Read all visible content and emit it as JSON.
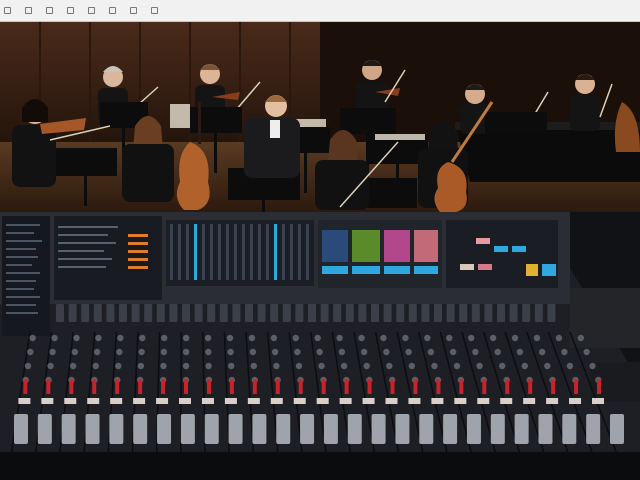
{
  "menu_bar": {
    "items": [
      "",
      "",
      "",
      "",
      "",
      "",
      "",
      "",
      "",
      ""
    ]
  },
  "scene": {
    "photo_colors": {
      "wall": "#3a2418",
      "floor": "#4a3020",
      "suit": "#141414",
      "wood": "#a5572a"
    },
    "musicians": [
      {
        "instrument": "violin"
      },
      {
        "instrument": "violin"
      },
      {
        "instrument": "violin"
      },
      {
        "instrument": "violin"
      },
      {
        "instrument": "violin"
      },
      {
        "instrument": "violin"
      },
      {
        "instrument": "viola"
      },
      {
        "instrument": "cello"
      },
      {
        "instrument": "cello"
      },
      {
        "instrument": "violin"
      },
      {
        "instrument": "violin"
      }
    ],
    "mixer_colors": {
      "body": "#2a2d33",
      "screen": "#15181e",
      "accent": "#2fa8e0",
      "knob_red": "#c8222a"
    },
    "channel_strip_count": 26,
    "thumbnail_icons": [
      "stage-thumbnail",
      "green-scene-thumbnail",
      "colorful-thumbnail",
      "face-thumbnail"
    ]
  }
}
